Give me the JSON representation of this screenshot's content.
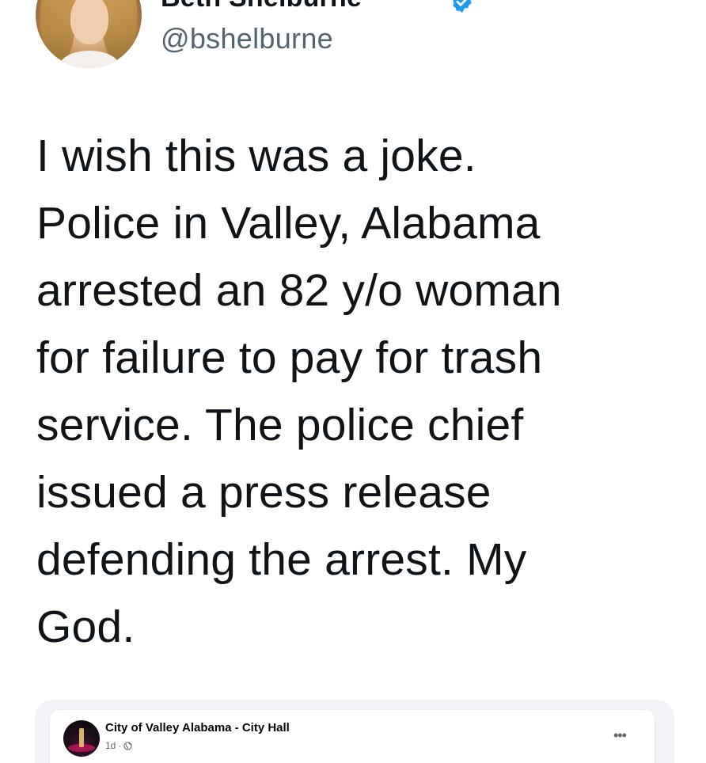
{
  "tweet": {
    "author": {
      "display_name": "Beth Shelburne",
      "handle": "@bshelburne",
      "verified": true
    },
    "text": "I wish this was a joke.\nPolice in Valley, Alabama\narrested an 82 y/o woman\nfor failure to pay for trash\nservice. The police chief\nissued a press release\ndefending the arrest. My\nGod."
  },
  "embedded_post": {
    "page_name": "City of Valley Alabama - City Hall",
    "time": "1d",
    "separator": "·",
    "audience_icon": "globe-icon",
    "menu_icon": "more-options-icon",
    "menu_glyph": "•••"
  },
  "colors": {
    "verified_badge": "#1d9bf0",
    "handle": "#536471",
    "text": "#0f1419",
    "facebook_meta": "#65676b"
  }
}
